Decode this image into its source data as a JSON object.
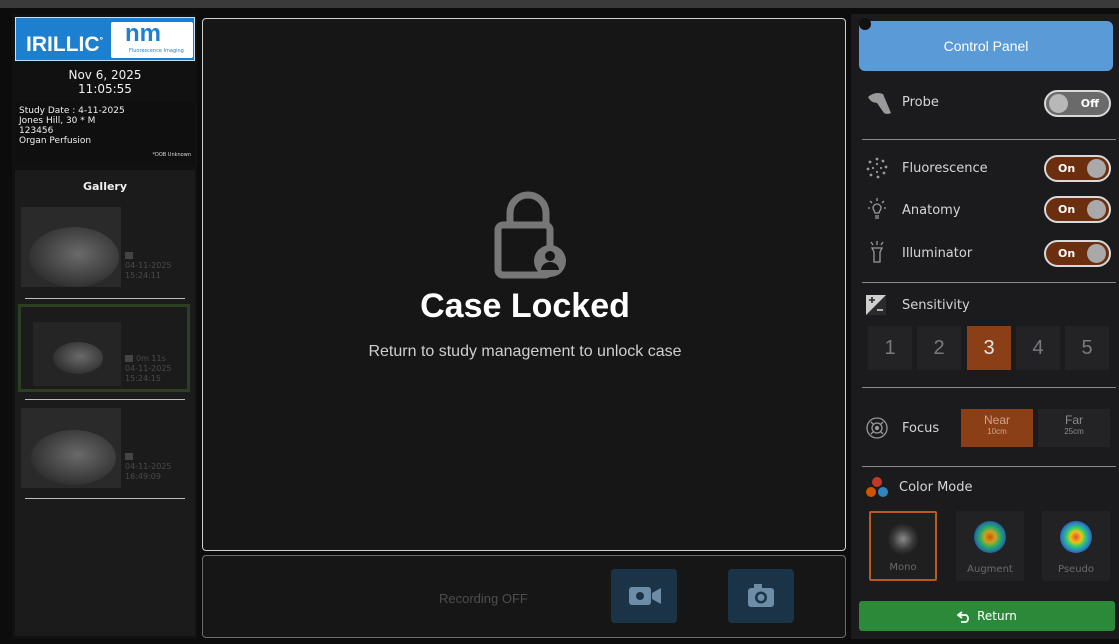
{
  "branding": {
    "brand1": "IRILLIC",
    "brand2": "nm",
    "brand2_sub": "Fluorescence Imaging"
  },
  "clock": {
    "date": "Nov 6, 2025",
    "time": "11:05:55"
  },
  "study": {
    "date_line": "Study Date : 4-11-2025",
    "patient_line": "Jones Hill, 30 * M",
    "id_line": "123456",
    "type_line": "Organ Perfusion",
    "dob_note": "*DOB Unknown"
  },
  "gallery": {
    "title": "Gallery",
    "items": [
      {
        "meta1": "",
        "date": "04-11-2025",
        "time": "15:24:11",
        "kind": "image"
      },
      {
        "meta1": "0m 11s",
        "date": "04-11-2025",
        "time": "15:24:15",
        "kind": "video"
      },
      {
        "meta1": "",
        "date": "04-11-2025",
        "time": "16:49:09",
        "kind": "image"
      }
    ]
  },
  "main": {
    "lock_title": "Case Locked",
    "lock_subtitle": "Return to study management to unlock case"
  },
  "recording": {
    "status": "Recording OFF"
  },
  "control_panel": {
    "title": "Control Panel",
    "probe": {
      "label": "Probe",
      "state": "Off"
    },
    "fluorescence": {
      "label": "Fluorescence",
      "state": "On"
    },
    "anatomy": {
      "label": "Anatomy",
      "state": "On"
    },
    "illuminator": {
      "label": "Illuminator",
      "state": "On"
    },
    "sensitivity": {
      "label": "Sensitivity",
      "levels": [
        "1",
        "2",
        "3",
        "4",
        "5"
      ],
      "selected": "3"
    },
    "focus": {
      "label": "Focus",
      "options": [
        {
          "name": "Near",
          "distance": "10cm"
        },
        {
          "name": "Far",
          "distance": "25cm"
        }
      ],
      "selected": "Near"
    },
    "color_mode": {
      "label": "Color Mode",
      "options": [
        "Mono",
        "Augment",
        "Pseudo"
      ],
      "selected": "Mono"
    },
    "return_label": "Return"
  },
  "colors": {
    "accent_orange": "#8a3f17",
    "panel_blue": "#5a9ad6",
    "return_green": "#2a8a3a"
  }
}
